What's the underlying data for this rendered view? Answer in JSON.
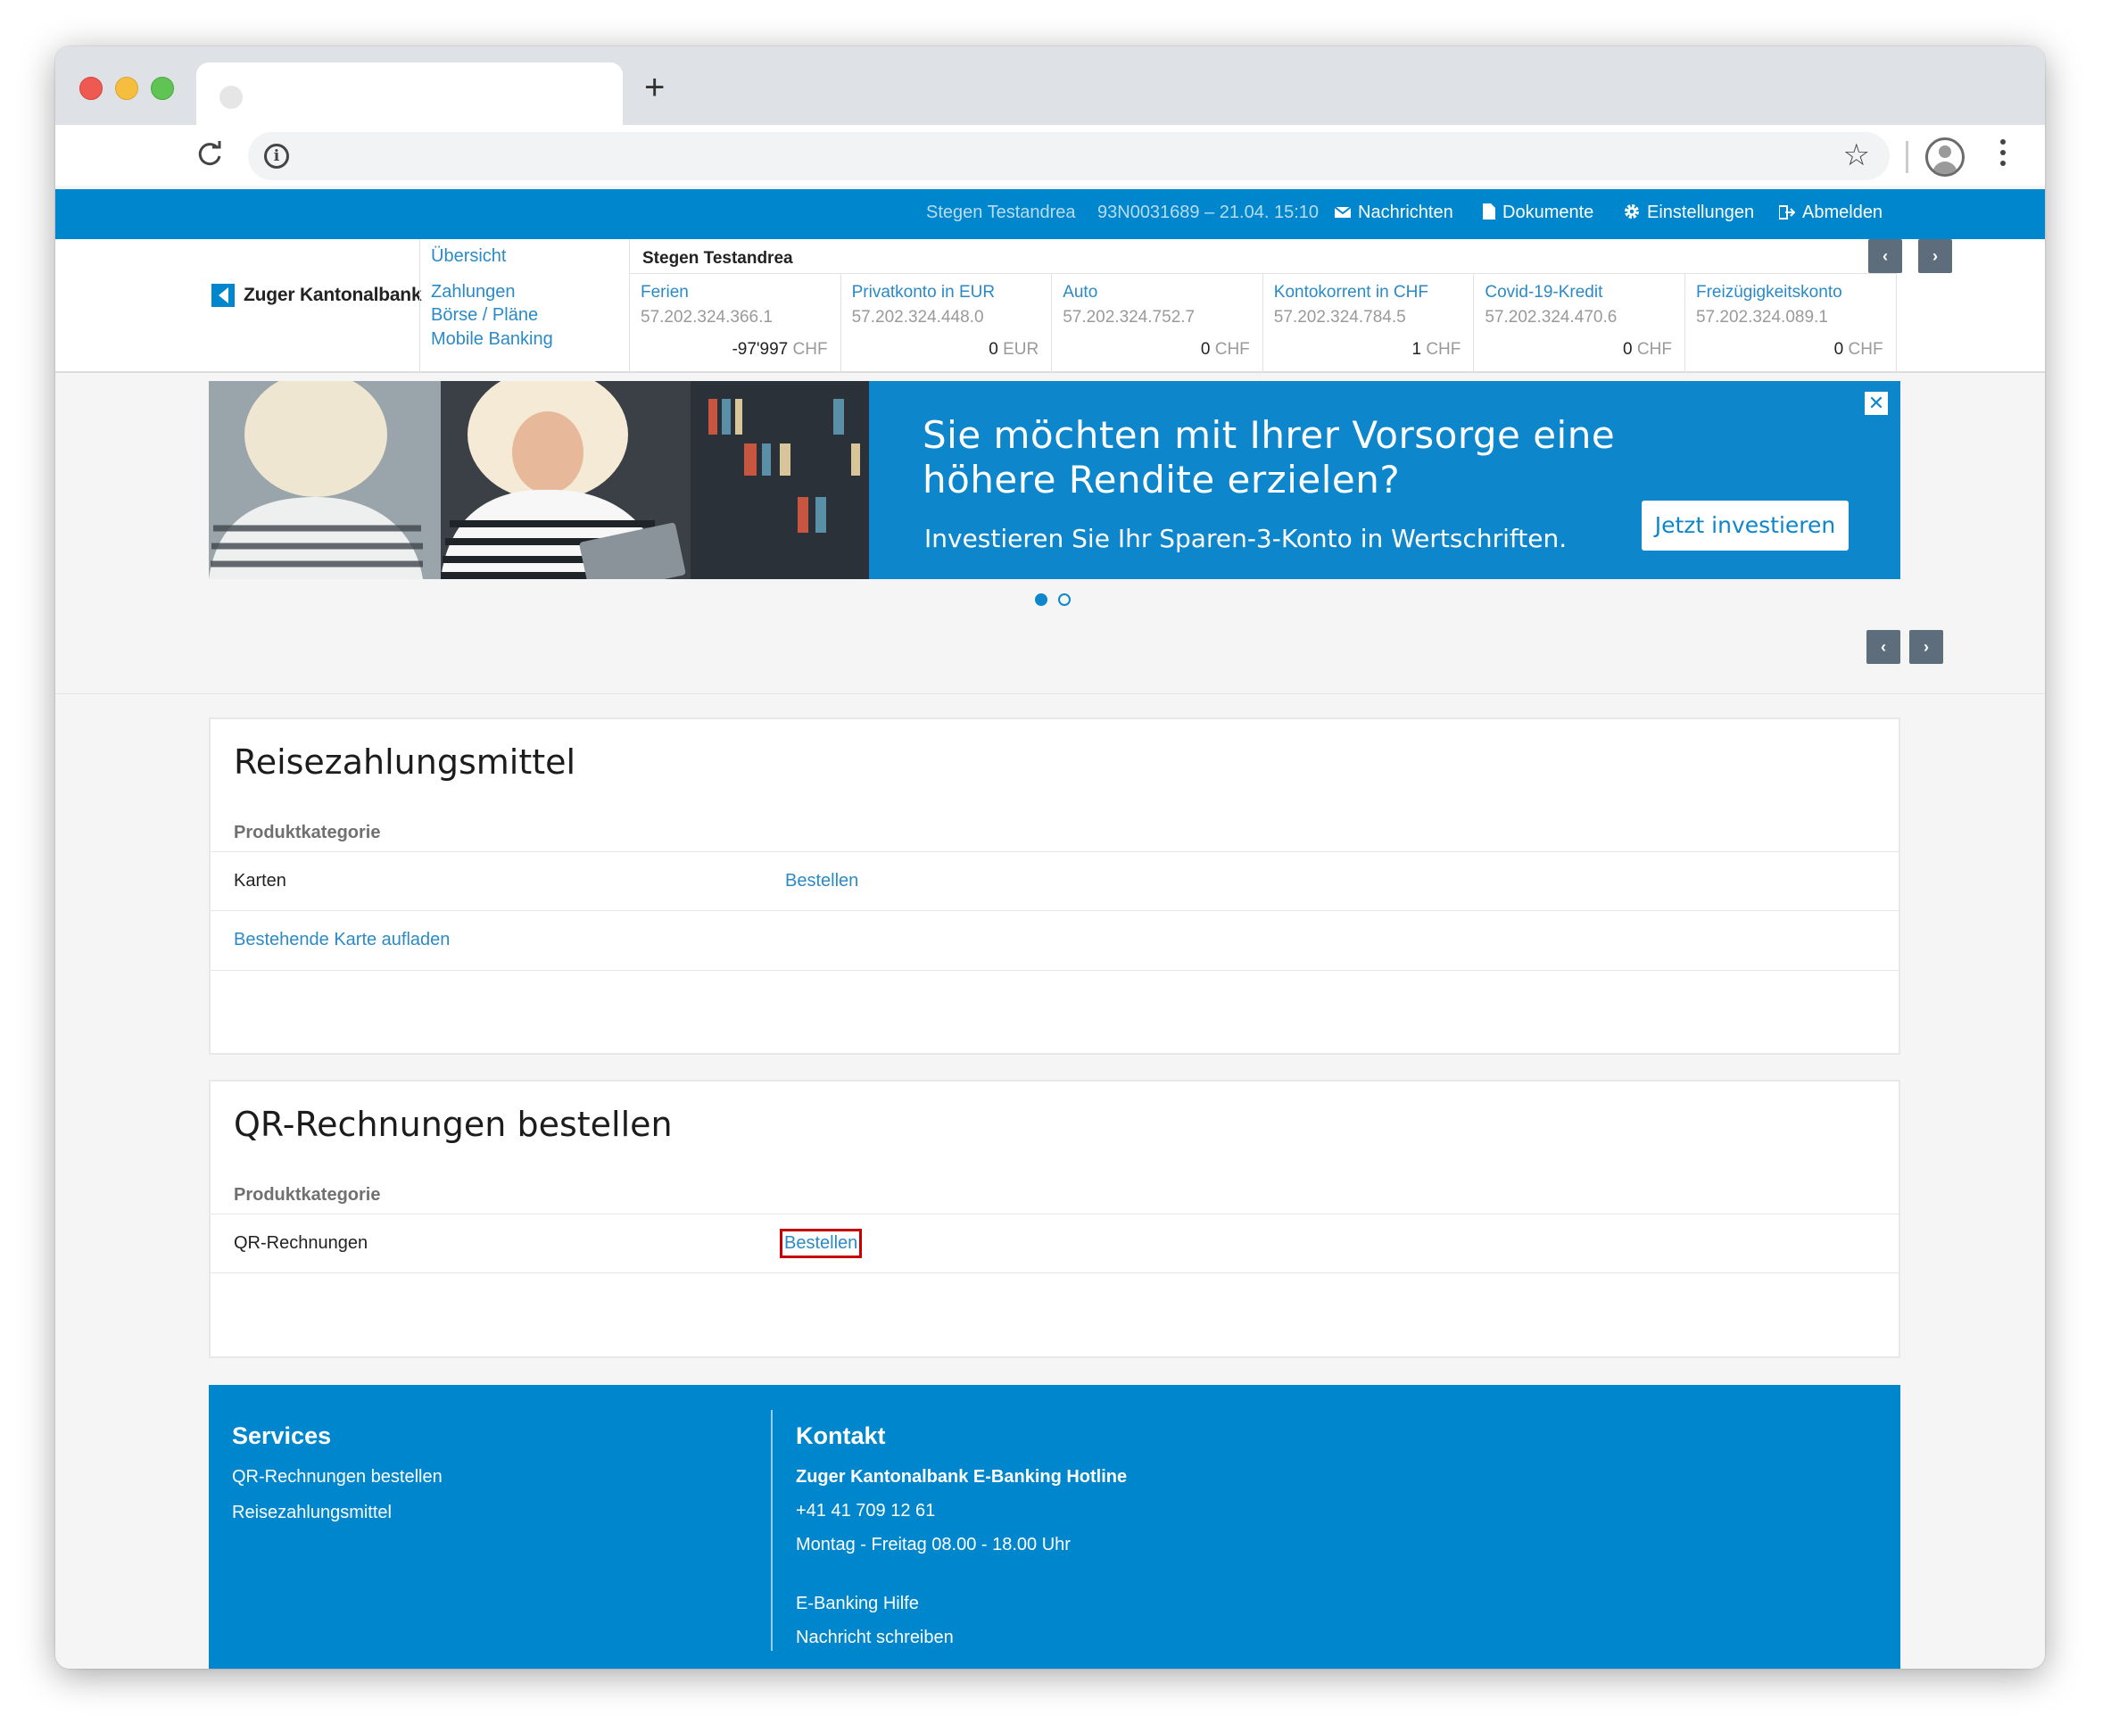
{
  "browser": {
    "new_tab": "+"
  },
  "topbar": {
    "user_name": "Stegen Testandrea",
    "session": "93N0031689 – 21.04. 15:10",
    "messages": "Nachrichten",
    "documents": "Dokumente",
    "settings": "Einstellungen",
    "logout": "Abmelden"
  },
  "brand": {
    "name": "Zuger Kantonalbank"
  },
  "nav": {
    "overview": "Übersicht",
    "payments": "Zahlungen",
    "exchange": "Börse / Pläne",
    "mobile": "Mobile Banking"
  },
  "accounts": {
    "owner": "Stegen Testandrea",
    "items": [
      {
        "name": "Ferien",
        "number": "57.202.324.366.1",
        "balance": "-97'997",
        "currency": "CHF"
      },
      {
        "name": "Privatkonto in EUR",
        "number": "57.202.324.448.0",
        "balance": "0",
        "currency": "EUR"
      },
      {
        "name": "Auto",
        "number": "57.202.324.752.7",
        "balance": "0",
        "currency": "CHF"
      },
      {
        "name": "Kontokorrent in CHF",
        "number": "57.202.324.784.5",
        "balance": "1",
        "currency": "CHF"
      },
      {
        "name": "Covid-19-Kredit",
        "number": "57.202.324.470.6",
        "balance": "0",
        "currency": "CHF"
      },
      {
        "name": "Freizügigkeitskonto",
        "number": "57.202.324.089.1",
        "balance": "0",
        "currency": "CHF"
      }
    ]
  },
  "banner": {
    "headline_1": "Sie möchten mit Ihrer Vorsorge eine",
    "headline_2": "höhere Rendite erzielen?",
    "subline": "Investieren Sie Ihr Sparen-3-Konto in Wertschriften.",
    "cta": "Jetzt investieren",
    "close": "✕",
    "slide_count": 2,
    "active_slide": 1
  },
  "travel_card": {
    "title": "Reisezahlungsmittel",
    "category_label": "Produktkategorie",
    "row_label": "Karten",
    "row_action": "Bestellen",
    "reload_link": "Bestehende Karte aufladen"
  },
  "qr_card": {
    "title": "QR-Rechnungen bestellen",
    "category_label": "Produktkategorie",
    "row_label": "QR-Rechnungen",
    "row_action": "Bestellen"
  },
  "footer": {
    "services_title": "Services",
    "services_links": [
      "QR-Rechnungen bestellen",
      "Reisezahlungsmittel"
    ],
    "contact_title": "Kontakt",
    "hotline_name": "Zuger Kantonalbank E-Banking Hotline",
    "phone": "+41 41 709 12 61",
    "hours": "Montag - Freitag 08.00 - 18.00 Uhr",
    "help": "E-Banking Hilfe",
    "write": "Nachricht schreiben"
  },
  "colors": {
    "brand_blue": "#0086cc",
    "link_blue": "#2b8ac6",
    "highlight_red": "#c40000"
  }
}
